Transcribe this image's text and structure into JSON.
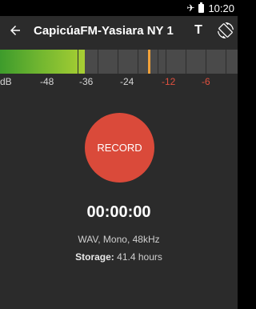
{
  "status_bar": {
    "time": "10:20",
    "icons": [
      "airplane-mode-icon",
      "battery-icon"
    ]
  },
  "toolbar": {
    "title": "CapicúaFM-Yasiara NY 1",
    "back_icon": "arrow-back-icon",
    "text_action_label": "T",
    "rotate_icon": "screen-rotation-icon"
  },
  "level_meter": {
    "current_level_db": -36.5,
    "peak_level_db": -18,
    "scale_labels": [
      {
        "text": "dB",
        "color": "#d6d6d6"
      },
      {
        "text": "-48",
        "color": "#d6d6d6"
      },
      {
        "text": "-36",
        "color": "#d6d6d6"
      },
      {
        "text": "-24",
        "color": "#d6d6d6"
      },
      {
        "text": "-12",
        "color": "#e0503f"
      },
      {
        "text": "-6",
        "color": "#e0503f"
      }
    ]
  },
  "record": {
    "button_label": "RECORD",
    "timer": "00:00:00"
  },
  "info": {
    "format": "WAV, Mono, 48kHz",
    "storage_label": "Storage:",
    "storage_value": "41.4 hours"
  },
  "colors": {
    "background": "#2b2b2b",
    "record_button": "#da4a3a",
    "meter_green": "#6fb530",
    "peak_marker": "#f2a23a",
    "hot_label": "#e0503f"
  }
}
